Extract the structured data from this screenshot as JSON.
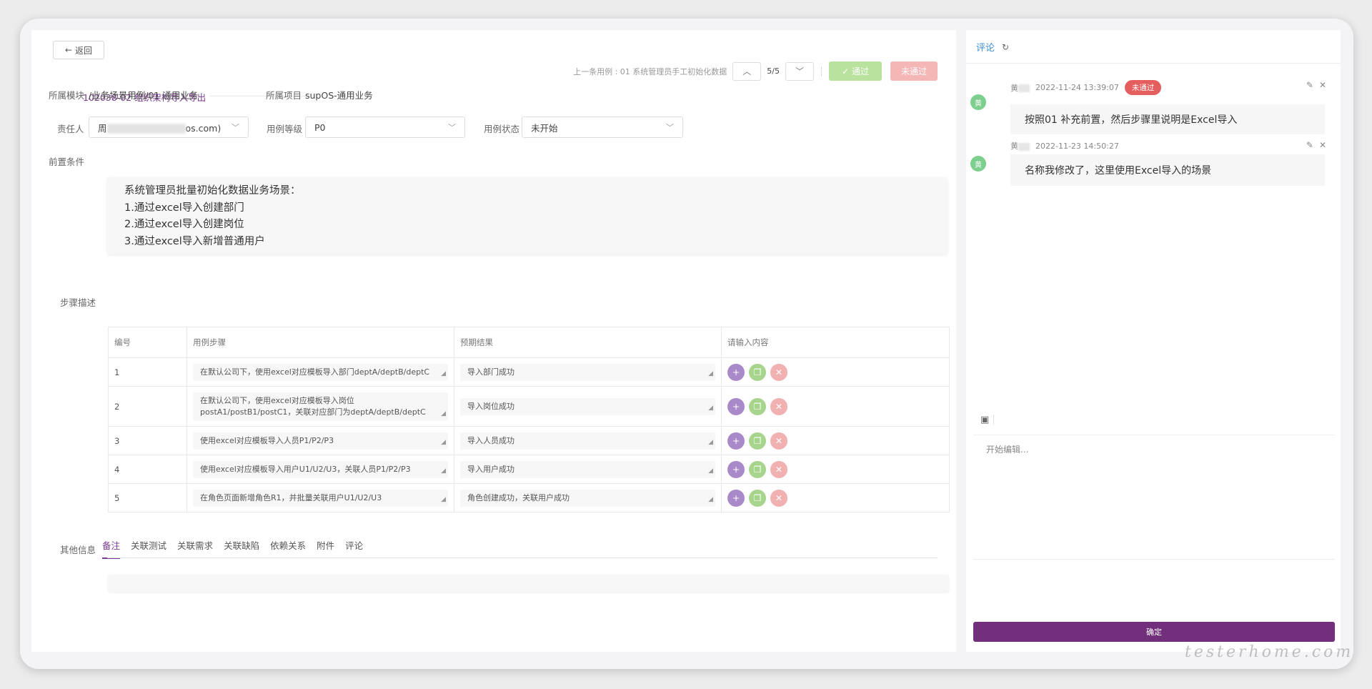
{
  "toolbar": {
    "back_label": "返回",
    "prev_case": "上一条用例 : 01 系统管理员手工初始化数据",
    "counter": "5/5",
    "pass_label": "通过",
    "fail_label": "未通过"
  },
  "case": {
    "title": "102038-02 组织架构导入导出",
    "module_label": "所属模块",
    "module_value": "/业务场景用例/01 通用业务",
    "project_label": "所属项目",
    "project_value": "supOS-通用业务",
    "owner_label": "责任人",
    "owner_prefix": "周",
    "owner_suffix": "os.com)",
    "level_label": "用例等级",
    "level_value": "P0",
    "status_label": "用例状态",
    "status_value": "未开始",
    "precond_label": "前置条件",
    "precond_lines": [
      "系统管理员批量初始化数据业务场景：",
      "1.通过excel导入创建部门",
      "2.通过excel导入创建岗位",
      "3.通过excel导入新增普通用户"
    ],
    "steps_label": "步骤描述"
  },
  "steps": {
    "headers": [
      "编号",
      "用例步骤",
      "预期结果",
      "请输入内容"
    ],
    "rows": [
      {
        "no": "1",
        "step": "在默认公司下，使用excel对应模板导入部门deptA/deptB/deptC",
        "expect": "导入部门成功"
      },
      {
        "no": "2",
        "step": "在默认公司下，使用excel对应模板导入岗位postA1/postB1/postC1，关联对应部门为deptA/deptB/deptC",
        "expect": "导入岗位成功"
      },
      {
        "no": "3",
        "step": "使用excel对应模板导入人员P1/P2/P3",
        "expect": "导入人员成功"
      },
      {
        "no": "4",
        "step": "使用excel对应模板导入用户U1/U2/U3，关联人员P1/P2/P3",
        "expect": "导入用户成功"
      },
      {
        "no": "5",
        "step": "在角色页面新增角色R1，并批量关联用户U1/U2/U3",
        "expect": "角色创建成功，关联用户成功"
      }
    ]
  },
  "tabs": {
    "label": "其他信息",
    "items": [
      "备注",
      "关联测试",
      "关联需求",
      "关联缺陷",
      "依赖关系",
      "附件",
      "评论"
    ]
  },
  "comments": {
    "title": "评论",
    "items": [
      {
        "avatar": "黄",
        "name": "黄",
        "time": "2022-11-24 13:39:07",
        "badge": "未通过",
        "text": "按照01 补充前置，然后步骤里说明是Excel导入"
      },
      {
        "avatar": "黄",
        "name": "黄",
        "time": "2022-11-23 14:50:27",
        "badge": "",
        "text": "名称我修改了，这里使用Excel导入的场景"
      }
    ],
    "editor_placeholder": "开始编辑...",
    "confirm_label": "确定"
  },
  "watermark": "testerhome.com",
  "colors": {
    "accent": "#7a3a8e",
    "confirm": "#722f7c",
    "pass": "#b8e29d",
    "fail": "#f5b6b6",
    "link": "#3b8ed8"
  }
}
